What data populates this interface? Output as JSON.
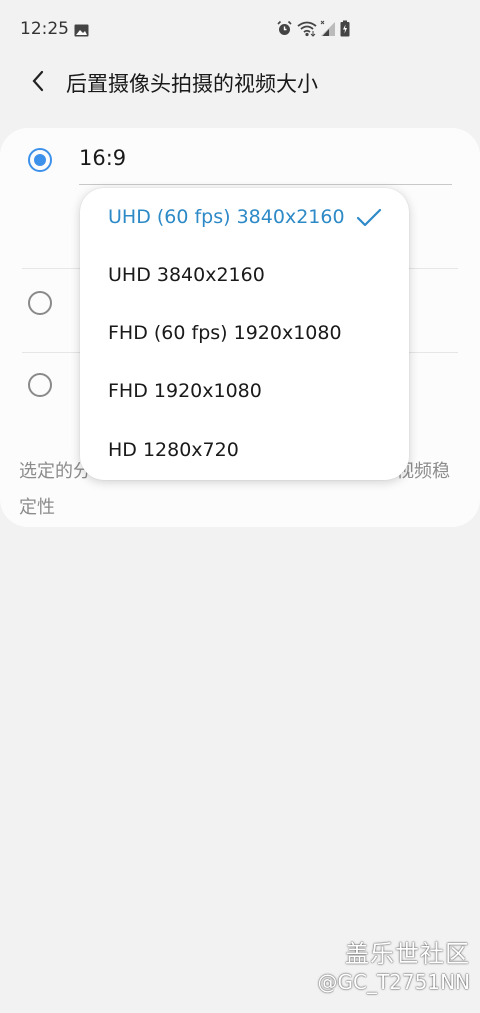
{
  "status_bar": {
    "time": "12:25",
    "icons": [
      "gallery-icon",
      "alarm-icon",
      "wifi-icon",
      "signal-icon",
      "battery-icon"
    ]
  },
  "header": {
    "back_icon": "chevron-left-icon",
    "title": "后置摄像头拍摄的视频大小"
  },
  "ratio_options": [
    {
      "label": "16:9",
      "selected": true
    },
    {
      "label": "",
      "selected": false
    },
    {
      "label": "",
      "selected": false
    }
  ],
  "hint": {
    "line1_left": "选定的分",
    "line1_right": "视频稳",
    "line2": "定性"
  },
  "resolution_menu": {
    "items": [
      {
        "label": "UHD (60 fps) 3840x2160",
        "selected": true
      },
      {
        "label": "UHD 3840x2160",
        "selected": false
      },
      {
        "label": "FHD (60 fps) 1920x1080",
        "selected": false
      },
      {
        "label": "FHD 1920x1080",
        "selected": false
      },
      {
        "label": "HD 1280x720",
        "selected": false
      }
    ]
  },
  "watermark": {
    "line1": "盖乐世社区",
    "line2": "@GC_T2751NN"
  },
  "colors": {
    "accent": "#3e91ea",
    "selected_text": "#2d8ac7",
    "background": "#f2f2f2"
  }
}
